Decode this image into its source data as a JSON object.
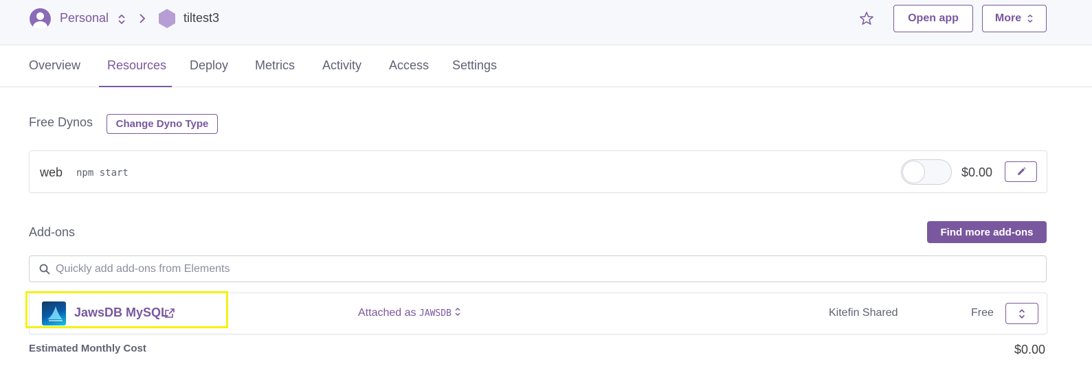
{
  "header": {
    "account_label": "Personal",
    "app_name": "tiltest3",
    "open_app_label": "Open app",
    "more_label": "More"
  },
  "tabs": [
    {
      "label": "Overview",
      "active": false
    },
    {
      "label": "Resources",
      "active": true
    },
    {
      "label": "Deploy",
      "active": false
    },
    {
      "label": "Metrics",
      "active": false
    },
    {
      "label": "Activity",
      "active": false
    },
    {
      "label": "Access",
      "active": false
    },
    {
      "label": "Settings",
      "active": false
    }
  ],
  "dynos": {
    "section_label": "Free Dynos",
    "change_button_label": "Change Dyno Type",
    "process": {
      "name": "web",
      "command": "npm start",
      "enabled": false,
      "cost": "$0.00"
    }
  },
  "addons": {
    "section_label": "Add-ons",
    "find_more_label": "Find more add-ons",
    "search_placeholder": "Quickly add add-ons from Elements",
    "items": [
      {
        "name": "JawsDB MySQL",
        "attached_prefix": "Attached as",
        "attached_as": "JAWSDB",
        "plan": "Kitefin Shared",
        "price": "Free"
      }
    ]
  },
  "estimate": {
    "label": "Estimated Monthly Cost",
    "value": "$0.00"
  },
  "colors": {
    "accent": "#79589f",
    "highlight": "#f5f212"
  }
}
